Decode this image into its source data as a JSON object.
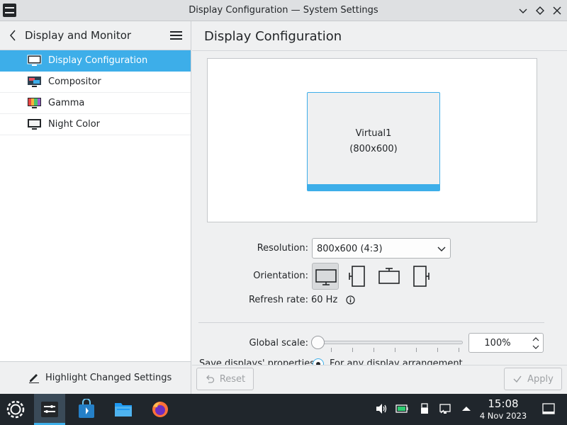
{
  "window": {
    "title": "Display Configuration — System Settings"
  },
  "sidebar": {
    "title": "Display and Monitor",
    "items": [
      {
        "label": "Display Configuration",
        "icon": "monitor-icon",
        "active": true
      },
      {
        "label": "Compositor",
        "icon": "compositor-icon"
      },
      {
        "label": "Gamma",
        "icon": "gamma-icon"
      },
      {
        "label": "Night Color",
        "icon": "night-color-icon"
      }
    ],
    "footer_label": "Highlight Changed Settings"
  },
  "main": {
    "title": "Display Configuration",
    "monitor": {
      "name": "Virtual1",
      "resolution": "(800x600)"
    },
    "resolution_label": "Resolution:",
    "resolution_value": "800x600 (4:3)",
    "orientation_label": "Orientation:",
    "refresh_label": "Refresh rate:",
    "refresh_value": "60 Hz",
    "scale_label": "Global scale:",
    "scale_value": "100%",
    "save_label": "Save displays' properties:",
    "save_option": "For any display arrangement",
    "reset_label": "Reset",
    "apply_label": "Apply"
  },
  "taskbar": {
    "time": "15:08",
    "date": "4 Nov 2023"
  },
  "colors": {
    "accent": "#3daee9",
    "taskbar": "#20262c"
  }
}
